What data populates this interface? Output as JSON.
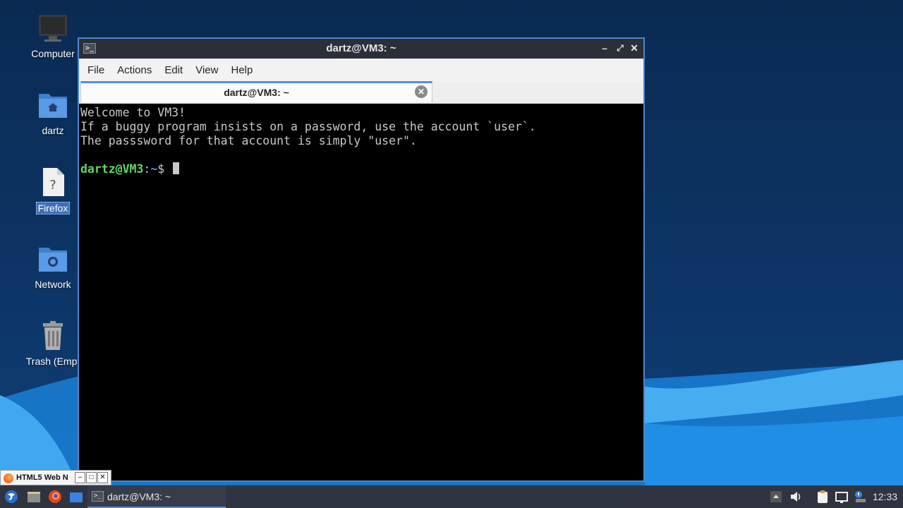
{
  "desktop": {
    "icons": [
      {
        "label": "Computer",
        "icon": "monitor-icon"
      },
      {
        "label": "dartz",
        "icon": "home-folder-icon"
      },
      {
        "label": "Firefox",
        "icon": "unknown-file-icon",
        "selected": true
      },
      {
        "label": "Network",
        "icon": "network-folder-icon"
      },
      {
        "label": "Trash (Empt",
        "icon": "trash-icon"
      }
    ]
  },
  "window": {
    "title": "dartz@VM3: ~",
    "title_icon": ">_",
    "menu": [
      "File",
      "Actions",
      "Edit",
      "View",
      "Help"
    ],
    "tab_label": "dartz@VM3: ~",
    "terminal": {
      "lines": [
        "Welcome to VM3!",
        "If a buggy program insists on a password, use the account `user`.",
        "The passsword for that account is simply \"user\"."
      ],
      "prompt_user": "dartz@VM3",
      "prompt_sep": ":",
      "prompt_path": "~",
      "prompt_symbol": "$"
    }
  },
  "mini_window": {
    "label": "HTML5 Web N"
  },
  "taskbar": {
    "task_label": "dartz@VM3: ~",
    "clock": "12:33"
  },
  "colors": {
    "accent": "#5b8fd6",
    "prompt_user": "#5fd75f",
    "prompt_path": "#5f87ff"
  }
}
